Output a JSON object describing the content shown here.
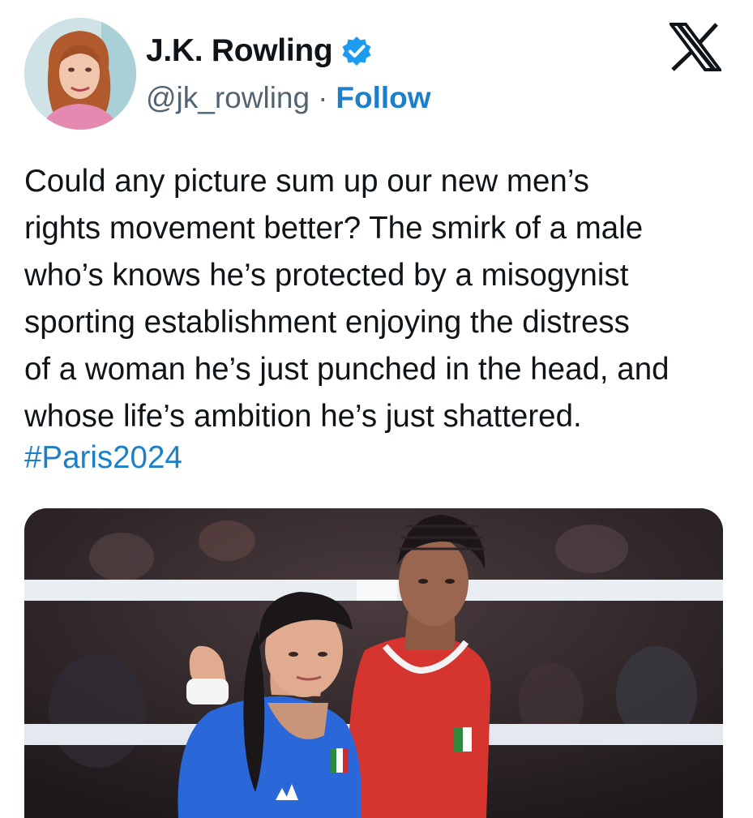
{
  "author": {
    "display_name": "J.K. Rowling",
    "handle": "@jk_rowling",
    "separator": "·",
    "follow_label": "Follow",
    "verified": true
  },
  "platform_logo": "x-logo-icon",
  "tweet": {
    "text_lines": [
      "Could any picture sum up our new men’s",
      "rights movement better? The smirk of a male",
      "who’s knows he’s protected by a misogynist",
      "sporting establishment enjoying the distress",
      "of a woman he’s just punched in the head, and",
      "whose life’s ambition he’s just shattered."
    ],
    "hashtag": "#Paris2024"
  },
  "colors": {
    "link": "#1d7fc8",
    "verified_badge": "#1d9bf0",
    "secondary_text": "#536471",
    "primary_text": "#0f1419"
  }
}
